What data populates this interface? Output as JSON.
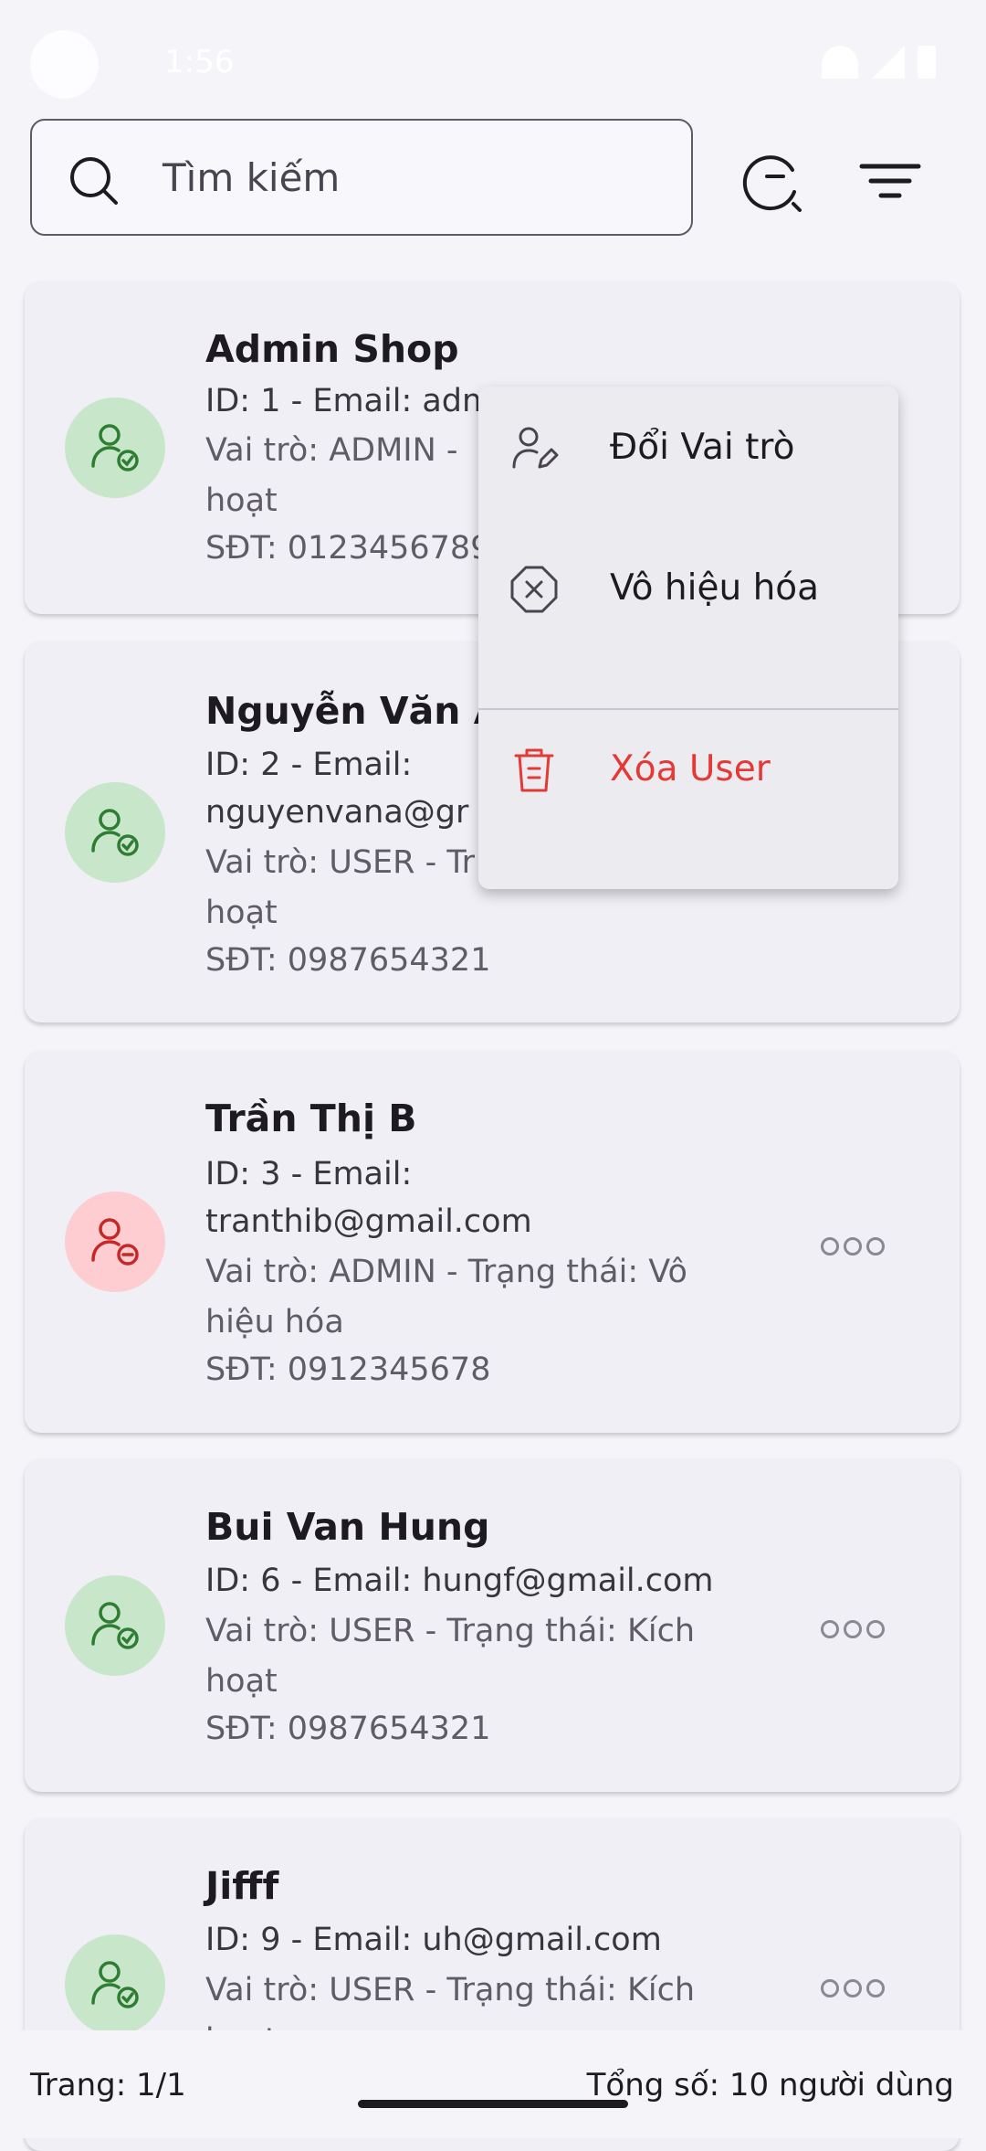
{
  "status_bar": {
    "time": "1:56"
  },
  "search": {
    "placeholder": "Tìm kiếm"
  },
  "users": [
    {
      "name": "Admin Shop",
      "line1": "ID: 1 - Email: adm",
      "line2": "",
      "line3": "Vai trò: ADMIN -",
      "line4": "hoạt",
      "phone": "SĐT: 0123456789",
      "status": "active"
    },
    {
      "name": "Nguyễn Văn A",
      "line1": "ID: 2 - Email:",
      "line2": "nguyenvana@gr",
      "line3": "Vai trò: USER - Tr",
      "line4": "hoạt",
      "phone": "SĐT: 0987654321",
      "status": "active"
    },
    {
      "name": "Trần Thị B",
      "line1": "ID: 3 - Email:",
      "line2": "tranthib@gmail.com",
      "line3": "Vai trò: ADMIN - Trạng thái: Vô",
      "line4": "hiệu hóa",
      "phone": "SĐT: 0912345678",
      "status": "disabled"
    },
    {
      "name": "Bui Van Hung",
      "line1": "ID: 6 - Email: hungf@gmail.com",
      "line2": "",
      "line3": "Vai trò: USER - Trạng thái: Kích",
      "line4": "hoạt",
      "phone": "SĐT: 0987654321",
      "status": "active"
    },
    {
      "name": "Jifff",
      "line1": "ID: 9 - Email: uh@gmail.com",
      "line2": "",
      "line3": "Vai trò: USER - Trạng thái: Kích",
      "line4": "hoạt",
      "phone": "",
      "status": "active"
    }
  ],
  "menu": {
    "change_role": "Đổi Vai trò",
    "disable": "Vô hiệu hóa",
    "delete": "Xóa User"
  },
  "footer": {
    "page": "Trang: 1/1",
    "total": "Tổng số: 10 người dùng"
  },
  "colors": {
    "active_avatar_bg": "#c8e6c9",
    "active_icon": "#2e7d32",
    "disabled_avatar_bg": "#fecdd2",
    "disabled_icon": "#c62828",
    "danger": "#e53935"
  }
}
